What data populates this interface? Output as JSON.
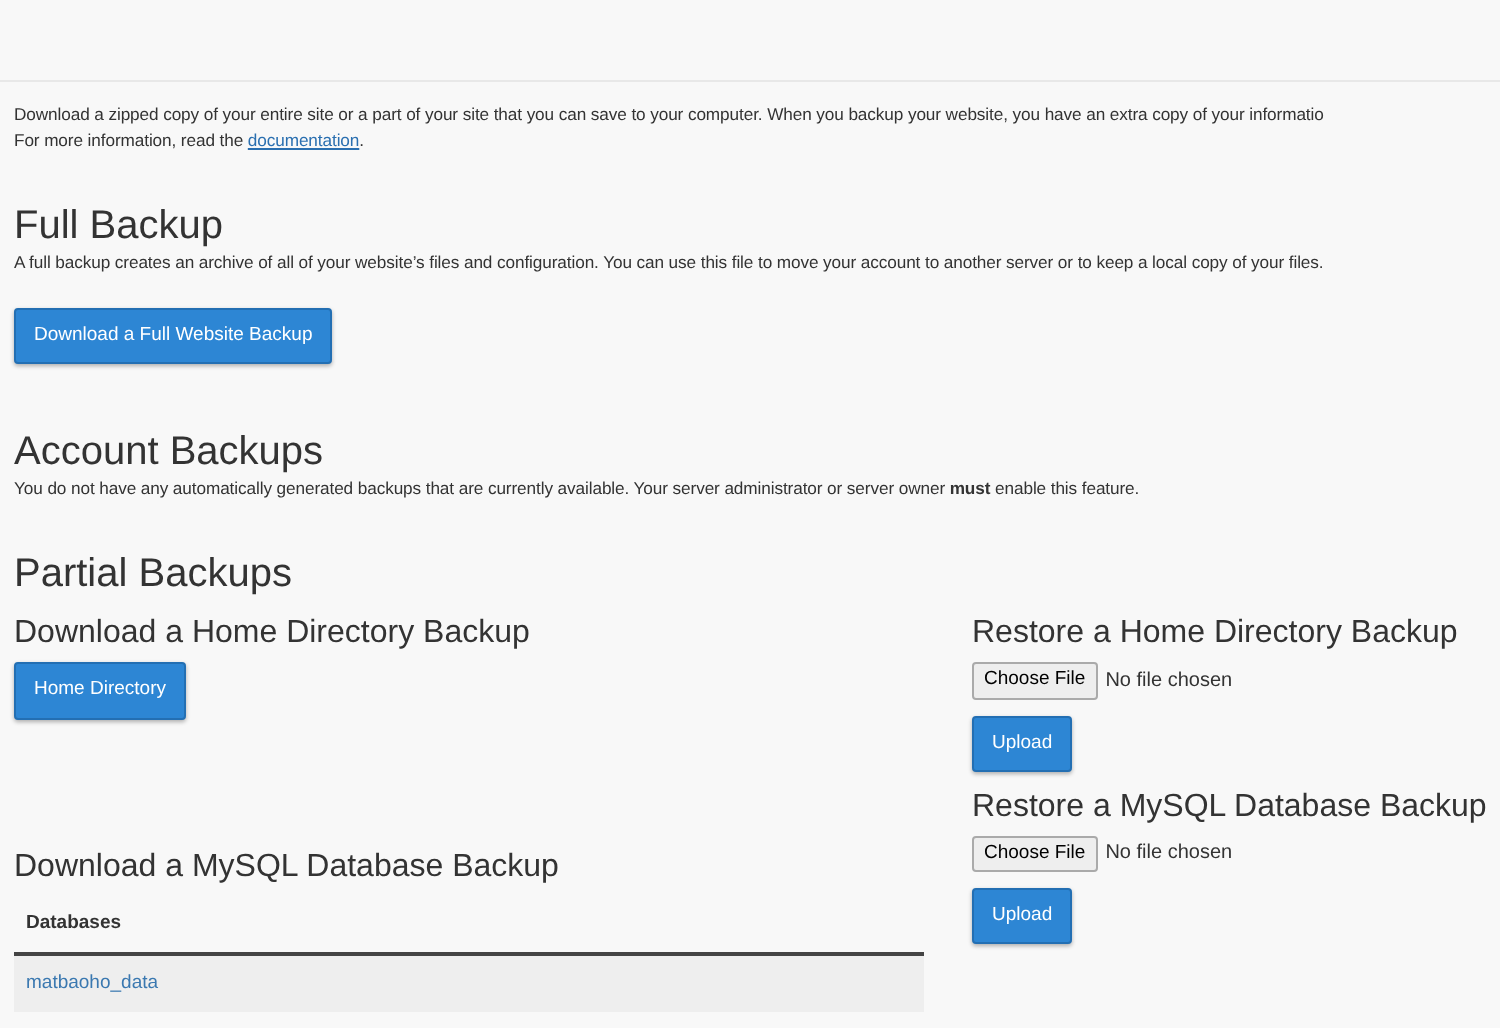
{
  "intro": {
    "line_1": "Download a zipped copy of your entire site or a part of your site that you can save to your computer. When you backup your website, you have an extra copy of your informatio",
    "line_2": "For more information, read the",
    "link": "documentation",
    "line_2_end": "."
  },
  "full_backup": {
    "title": "Full Backup",
    "description": "A full backup creates an archive of all of your website’s files and configuration. You can use this file to move your account to another server or to keep a local copy of your files.",
    "button": "Download a Full Website Backup"
  },
  "account_backups": {
    "title": "Account Backups",
    "description": "You do not have any automatically generated backups that are currently available. Your server administrator or server owner **must** enable this feature."
  },
  "partial_backups": {
    "title": "Partial Backups",
    "home_download": {
      "title": "Download a Home Directory Backup",
      "button": "Home Directory"
    },
    "home_restore": {
      "title": "Restore a Home Directory Backup",
      "file_button": "Choose File",
      "file_status": "No file chosen",
      "button": "Upload"
    },
    "mysql_download": {
      "title": "Download a MySQL Database Backup",
      "table": {
        "columns": [
          "Databases"
        ],
        "rows": [
          [
            "matbaoho_data"
          ]
        ]
      }
    },
    "mysql_restore": {
      "title": "Restore a MySQL Database Backup",
      "file_button": "Choose File",
      "file_status": "No file chosen",
      "button": "Upload"
    }
  }
}
